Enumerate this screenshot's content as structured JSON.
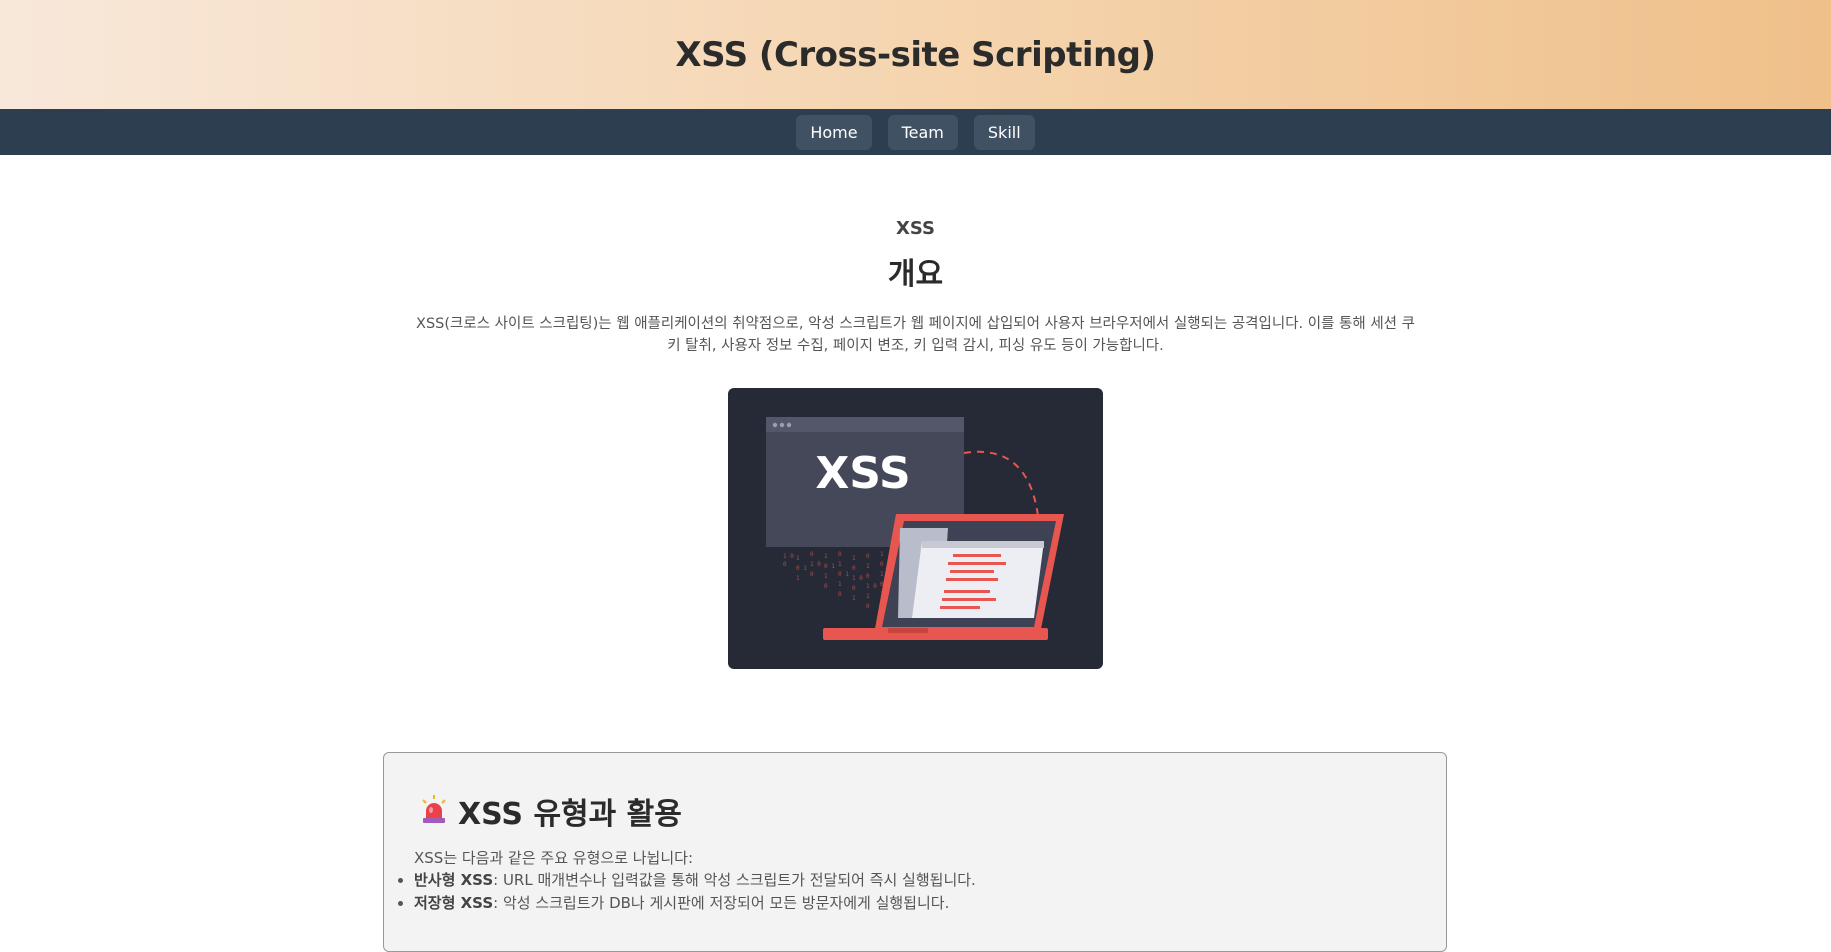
{
  "header": {
    "title": "XSS (Cross-site Scripting)"
  },
  "nav": {
    "items": [
      "Home",
      "Team",
      "Skill"
    ]
  },
  "intro": {
    "overline": "XSS",
    "heading": "개요",
    "description": "XSS(크로스 사이트 스크립팅)는 웹 애플리케이션의 취약점으로, 악성 스크립트가 웹 페이지에 삽입되어 사용자 브라우저에서 실행되는 공격입니다. 이를 통해 세션 쿠키 탈취, 사용자 정보 수집, 페이지 변조, 키 입력 감시, 피싱 유도 등이 가능합니다."
  },
  "figure": {
    "label": "XSS"
  },
  "types_section": {
    "icon": "siren-icon",
    "title": "XSS 유형과 활용",
    "intro": "XSS는 다음과 같은 주요 유형으로 나뉩니다:",
    "items": [
      {
        "term": "반사형 XSS",
        "text": ": URL 매개변수나 입력값을 통해 악성 스크립트가 전달되어 즉시 실행됩니다."
      },
      {
        "term": "저장형 XSS",
        "text": ": 악성 스크립트가 DB나 게시판에 저장되어 모든 방문자에게 실행됩니다."
      }
    ]
  }
}
